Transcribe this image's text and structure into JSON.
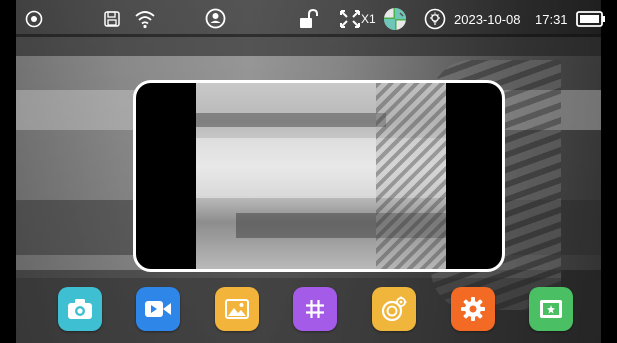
{
  "status_bar": {
    "icons": [
      "record-dot-icon",
      "save-icon",
      "wifi-icon",
      "user-icon",
      "unlock-icon",
      "zoom-icon",
      "compass-icon",
      "brightness-icon",
      "battery-icon"
    ],
    "zoom_level": "X1",
    "date": "2023-10-08",
    "time": "17:31"
  },
  "dock": {
    "apps": [
      {
        "name": "camera",
        "color": "#3FC0D2"
      },
      {
        "name": "video",
        "color": "#2E86E8"
      },
      {
        "name": "gallery",
        "color": "#F2B43A"
      },
      {
        "name": "grid",
        "color": "#A35BE8"
      },
      {
        "name": "camera-settings",
        "color": "#F0B53B"
      },
      {
        "name": "settings",
        "color": "#F26A24"
      },
      {
        "name": "screen",
        "color": "#4BBF63"
      }
    ]
  }
}
